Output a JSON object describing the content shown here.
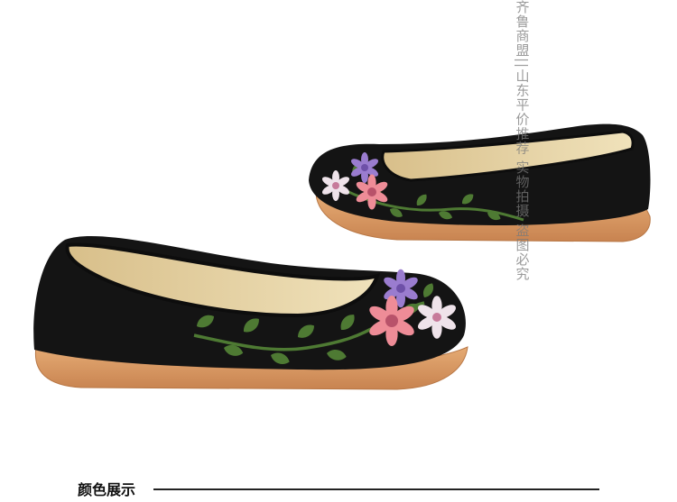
{
  "photo": {
    "description_alt": "Pair of black embroidered cloth flat shoes",
    "colors": {
      "upper": "#141414",
      "lining": "#e9d7a8",
      "sole": "#d99a63",
      "leaf": "#4e7a33",
      "pink_flower": "#ee8c97",
      "purple_flower": "#9a7ccf",
      "white_flower": "#efe3ea"
    }
  },
  "watermark": {
    "text": "齐鲁商盟||山东平价推荐 实物拍摄 盗图必究"
  },
  "caption": {
    "label": "颜色展示"
  }
}
